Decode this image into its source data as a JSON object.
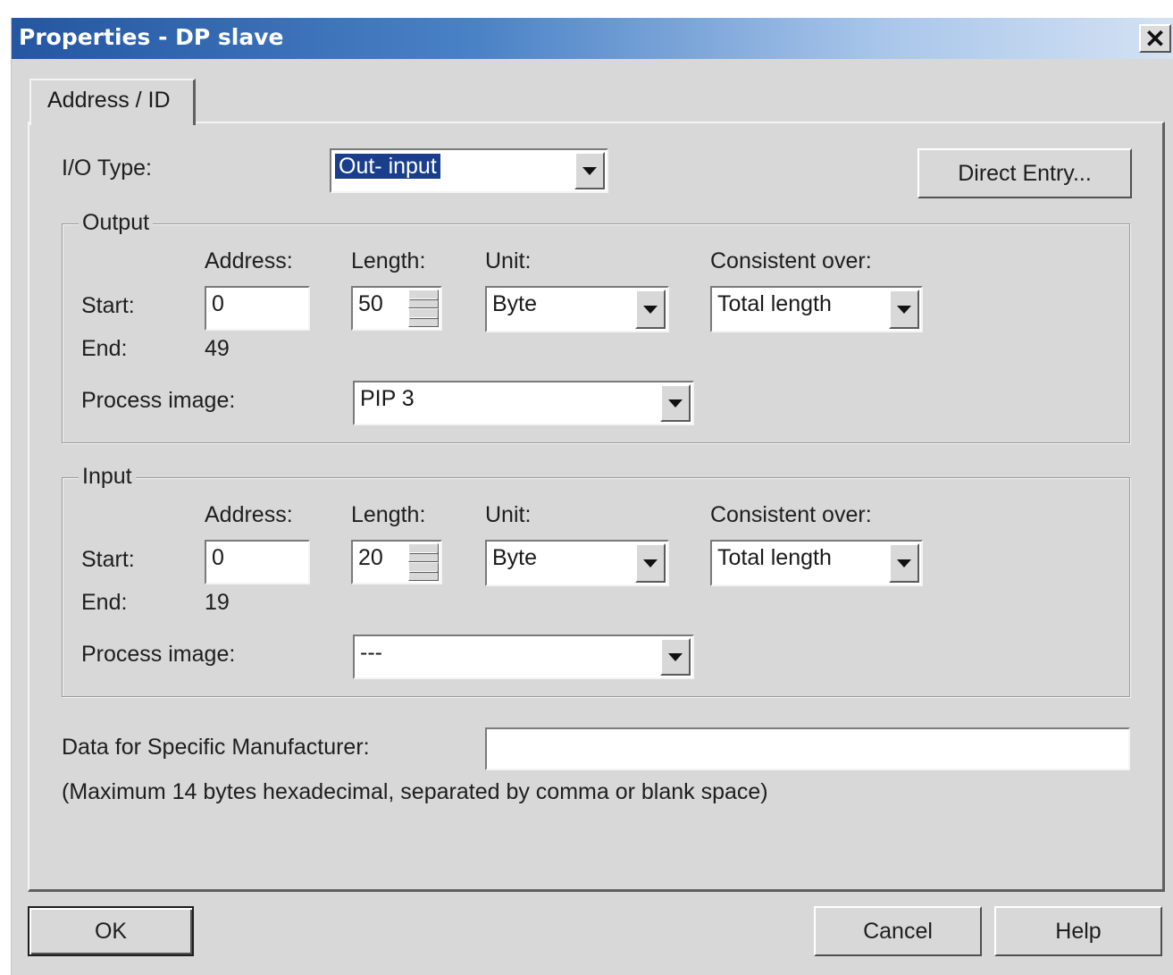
{
  "window": {
    "title": "Properties - DP slave",
    "close_symbol": "✕"
  },
  "tabs": [
    {
      "label": "Address / ID"
    }
  ],
  "io_type": {
    "label": "I/O Type:",
    "value": "Out- input"
  },
  "direct_entry_button": "Direct Entry...",
  "output": {
    "group_label": "Output",
    "address_header": "Address:",
    "length_header": "Length:",
    "unit_header": "Unit:",
    "consistent_header": "Consistent over:",
    "start_label": "Start:",
    "end_label": "End:",
    "start_address": "0",
    "length": "50",
    "unit": "Byte",
    "consistent_over": "Total length",
    "end_value": "49",
    "process_image_label": "Process image:",
    "process_image": "PIP 3"
  },
  "input": {
    "group_label": "Input",
    "address_header": "Address:",
    "length_header": "Length:",
    "unit_header": "Unit:",
    "consistent_header": "Consistent over:",
    "start_label": "Start:",
    "end_label": "End:",
    "start_address": "0",
    "length": "20",
    "unit": "Byte",
    "consistent_over": "Total length",
    "end_value": "19",
    "process_image_label": "Process image:",
    "process_image": "---"
  },
  "manufacturer": {
    "label": "Data for Specific Manufacturer:",
    "value": "",
    "hint": "(Maximum 14 bytes hexadecimal, separated by comma or blank space)"
  },
  "buttons": {
    "ok": "OK",
    "cancel": "Cancel",
    "help": "Help"
  }
}
